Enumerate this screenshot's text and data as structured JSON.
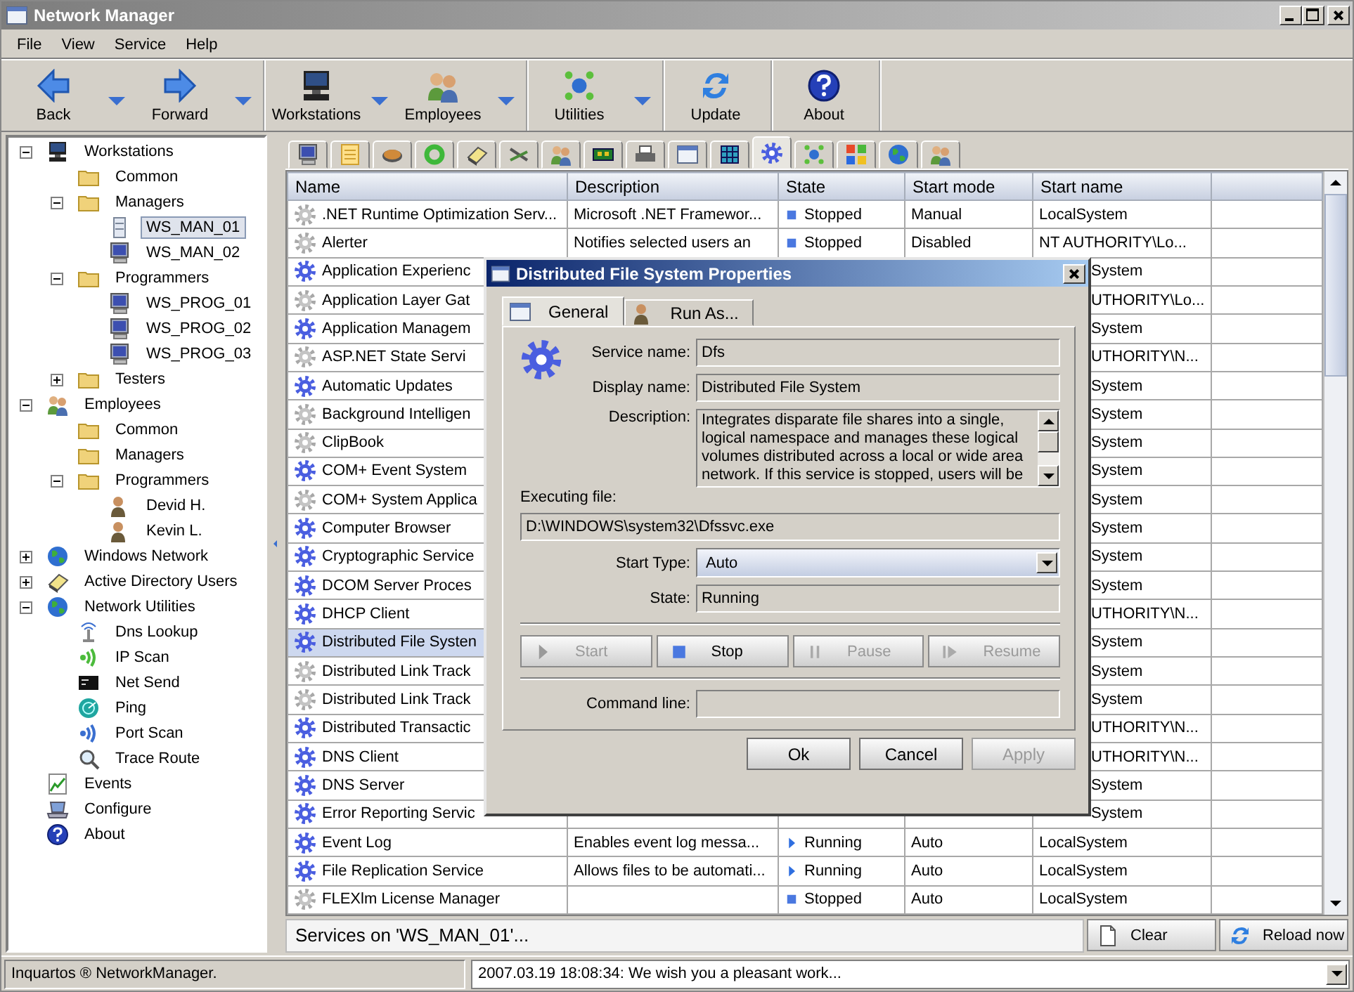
{
  "window": {
    "title": "Network Manager"
  },
  "menu": [
    "File",
    "View",
    "Service",
    "Help"
  ],
  "toolbar": {
    "groups": [
      {
        "buttons": [
          {
            "label": "Back",
            "kind": "back",
            "dropdown": true
          },
          {
            "label": "Forward",
            "kind": "forward",
            "dropdown": true
          }
        ]
      },
      {
        "buttons": [
          {
            "label": "Workstations",
            "kind": "computer",
            "dropdown": true
          },
          {
            "label": "Employees",
            "kind": "people",
            "dropdown": true
          }
        ]
      },
      {
        "buttons": [
          {
            "label": "Utilities",
            "kind": "network",
            "dropdown": true
          }
        ]
      },
      {
        "buttons": [
          {
            "label": "Update",
            "kind": "refresh",
            "dropdown": false
          }
        ]
      },
      {
        "buttons": [
          {
            "label": "About",
            "kind": "help",
            "dropdown": false
          }
        ]
      }
    ]
  },
  "tree": [
    {
      "label": "Workstations",
      "kind": "computer",
      "expanded": true,
      "selected": false,
      "children": [
        {
          "label": "Common",
          "kind": "folder",
          "selected": false
        },
        {
          "label": "Managers",
          "kind": "folder",
          "expanded": true,
          "selected": false,
          "children": [
            {
              "label": "WS_MAN_01",
              "kind": "server",
              "selected": true
            },
            {
              "label": "WS_MAN_02",
              "kind": "monitor",
              "selected": false
            }
          ]
        },
        {
          "label": "Programmers",
          "kind": "folder",
          "expanded": true,
          "selected": false,
          "children": [
            {
              "label": "WS_PROG_01",
              "kind": "monitor",
              "selected": false
            },
            {
              "label": "WS_PROG_02",
              "kind": "monitor",
              "selected": false
            },
            {
              "label": "WS_PROG_03",
              "kind": "monitor",
              "selected": false
            }
          ]
        },
        {
          "label": "Testers",
          "kind": "folder",
          "expanded": false,
          "selected": false
        }
      ]
    },
    {
      "label": "Employees",
      "kind": "people",
      "expanded": true,
      "selected": false,
      "children": [
        {
          "label": "Common",
          "kind": "folder",
          "selected": false
        },
        {
          "label": "Managers",
          "kind": "folder",
          "selected": false
        },
        {
          "label": "Programmers",
          "kind": "folder",
          "expanded": true,
          "selected": false,
          "children": [
            {
              "label": "Devid H.",
              "kind": "person",
              "selected": false
            },
            {
              "label": "Kevin L.",
              "kind": "person",
              "selected": false
            }
          ]
        }
      ]
    },
    {
      "label": "Windows Network",
      "kind": "globe",
      "expanded": false,
      "selected": false
    },
    {
      "label": "Active Directory Users",
      "kind": "book",
      "expanded": false,
      "selected": false
    },
    {
      "label": "Network Utilities",
      "kind": "globe",
      "expanded": true,
      "selected": false,
      "children": [
        {
          "label": "Dns Lookup",
          "kind": "antenna",
          "selected": false
        },
        {
          "label": "IP Scan",
          "kind": "signal",
          "selected": false
        },
        {
          "label": "Net Send",
          "kind": "terminal",
          "selected": false
        },
        {
          "label": "Ping",
          "kind": "radar",
          "selected": false
        },
        {
          "label": "Port Scan",
          "kind": "wave",
          "selected": false
        },
        {
          "label": "Trace Route",
          "kind": "magnifier",
          "selected": false
        }
      ]
    },
    {
      "label": "Events",
      "kind": "chart",
      "selected": false
    },
    {
      "label": "Configure",
      "kind": "laptop",
      "selected": false
    },
    {
      "label": "About",
      "kind": "help",
      "selected": false
    }
  ],
  "view_tabs": [
    {
      "kind": "monitor",
      "selected": false
    },
    {
      "kind": "note",
      "selected": false
    },
    {
      "kind": "disk",
      "selected": false
    },
    {
      "kind": "ring",
      "selected": false
    },
    {
      "kind": "book",
      "selected": false
    },
    {
      "kind": "tools",
      "selected": false
    },
    {
      "kind": "people",
      "selected": false
    },
    {
      "kind": "chip",
      "selected": false
    },
    {
      "kind": "printer",
      "selected": false
    },
    {
      "kind": "window",
      "selected": false
    },
    {
      "kind": "grid",
      "selected": false
    },
    {
      "kind": "gear",
      "selected": true
    },
    {
      "kind": "network",
      "selected": false
    },
    {
      "kind": "tiles",
      "selected": false
    },
    {
      "kind": "globe",
      "selected": false
    },
    {
      "kind": "people",
      "selected": false
    }
  ],
  "table": {
    "columns": [
      "Name",
      "Description",
      "State",
      "Start mode",
      "Start name"
    ],
    "rows": [
      {
        "name": ".NET Runtime Optimization Serv...",
        "description": "Microsoft .NET Framewor...",
        "running": false,
        "state": "Stopped",
        "start_mode": "Manual",
        "start_name": "LocalSystem",
        "selected": false
      },
      {
        "name": "Alerter",
        "description": "Notifies selected users an",
        "running": false,
        "state": "Stopped",
        "start_mode": "Disabled",
        "start_name": "NT AUTHORITY\\Lo...",
        "selected": false
      },
      {
        "name": "Application Experienc",
        "running": true,
        "start_name": "System",
        "selected": false
      },
      {
        "name": "Application Layer Gat",
        "running": false,
        "start_name": "UTHORITY\\Lo...",
        "selected": false
      },
      {
        "name": "Application Managem",
        "running": true,
        "start_name": "System",
        "selected": false
      },
      {
        "name": "ASP.NET State Servi",
        "running": false,
        "start_name": "UTHORITY\\N...",
        "selected": false
      },
      {
        "name": "Automatic Updates",
        "running": true,
        "start_name": "System",
        "selected": false
      },
      {
        "name": "Background Intelligen",
        "running": false,
        "start_name": "System",
        "selected": false
      },
      {
        "name": "ClipBook",
        "running": false,
        "start_name": "System",
        "selected": false
      },
      {
        "name": "COM+ Event System",
        "running": true,
        "start_name": "System",
        "selected": false
      },
      {
        "name": "COM+ System Applica",
        "running": false,
        "start_name": "System",
        "selected": false
      },
      {
        "name": "Computer Browser",
        "running": true,
        "start_name": "System",
        "selected": false
      },
      {
        "name": "Cryptographic Service",
        "running": true,
        "start_name": "System",
        "selected": false
      },
      {
        "name": "DCOM Server Proces",
        "running": true,
        "start_name": "System",
        "selected": false
      },
      {
        "name": "DHCP Client",
        "running": true,
        "start_name": "UTHORITY\\N...",
        "selected": false
      },
      {
        "name": "Distributed File Systen",
        "running": true,
        "start_name": "System",
        "selected": true
      },
      {
        "name": "Distributed Link Track",
        "running": false,
        "start_name": "System",
        "selected": false
      },
      {
        "name": "Distributed Link Track",
        "running": false,
        "start_name": "System",
        "selected": false
      },
      {
        "name": "Distributed Transactic",
        "running": true,
        "start_name": "UTHORITY\\N...",
        "selected": false
      },
      {
        "name": "DNS Client",
        "running": true,
        "start_name": "UTHORITY\\N...",
        "selected": false
      },
      {
        "name": "DNS Server",
        "running": true,
        "start_name": "System",
        "selected": false
      },
      {
        "name": "Error Reporting Servic",
        "running": true,
        "start_name": "System",
        "selected": false
      },
      {
        "name": "Event Log",
        "description": "Enables event log messa...",
        "running": true,
        "state": "Running",
        "start_mode": "Auto",
        "start_name": "LocalSystem",
        "selected": false
      },
      {
        "name": "File Replication Service",
        "description": "Allows files to be automati...",
        "running": true,
        "state": "Running",
        "start_mode": "Auto",
        "start_name": "LocalSystem",
        "selected": false
      },
      {
        "name": "FLEXlm License Manager",
        "running": false,
        "state": "Stopped",
        "start_mode": "Auto",
        "start_name": "LocalSystem",
        "selected": false
      }
    ]
  },
  "bottom_bar": {
    "label": "Services on 'WS_MAN_01'...",
    "buttons": [
      {
        "label": "Clear",
        "kind": "document"
      },
      {
        "label": "Reload now",
        "kind": "refresh"
      }
    ]
  },
  "status_bar": {
    "text": "Inquartos ® NetworkManager.",
    "log": "2007.03.19 18:08:34: We wish you a pleasant work..."
  },
  "dialog": {
    "title": "Distributed File System Properties",
    "tabs": [
      {
        "label": "General",
        "kind": "window",
        "selected": true
      },
      {
        "label": "Run As...",
        "kind": "person",
        "selected": false
      }
    ],
    "fields": [
      {
        "label": "Service name:",
        "value": "Dfs"
      },
      {
        "label": "Display name:",
        "value": "Distributed File System"
      }
    ],
    "description": {
      "label": "Description:",
      "value": "Integrates disparate file shares into a single, logical namespace and manages these logical volumes distributed across a local or wide area network. If this service is stopped, users will be"
    },
    "executing_file": {
      "label": "Executing file:",
      "value": "D:\\WINDOWS\\system32\\Dfssvc.exe"
    },
    "start_type": {
      "label": "Start Type:",
      "value": "Auto"
    },
    "state": {
      "label": "State:",
      "value": "Running"
    },
    "actions": [
      {
        "label": "Start",
        "kind": "play",
        "disabled": true
      },
      {
        "label": "Stop",
        "kind": "stop",
        "disabled": false
      },
      {
        "label": "Pause",
        "kind": "pause",
        "disabled": true
      },
      {
        "label": "Resume",
        "kind": "resume",
        "disabled": true
      }
    ],
    "command_line": {
      "label": "Command line:"
    },
    "buttons": [
      {
        "label": "Ok",
        "disabled": false
      },
      {
        "label": "Cancel",
        "disabled": false
      },
      {
        "label": "Apply",
        "disabled": true
      }
    ]
  }
}
